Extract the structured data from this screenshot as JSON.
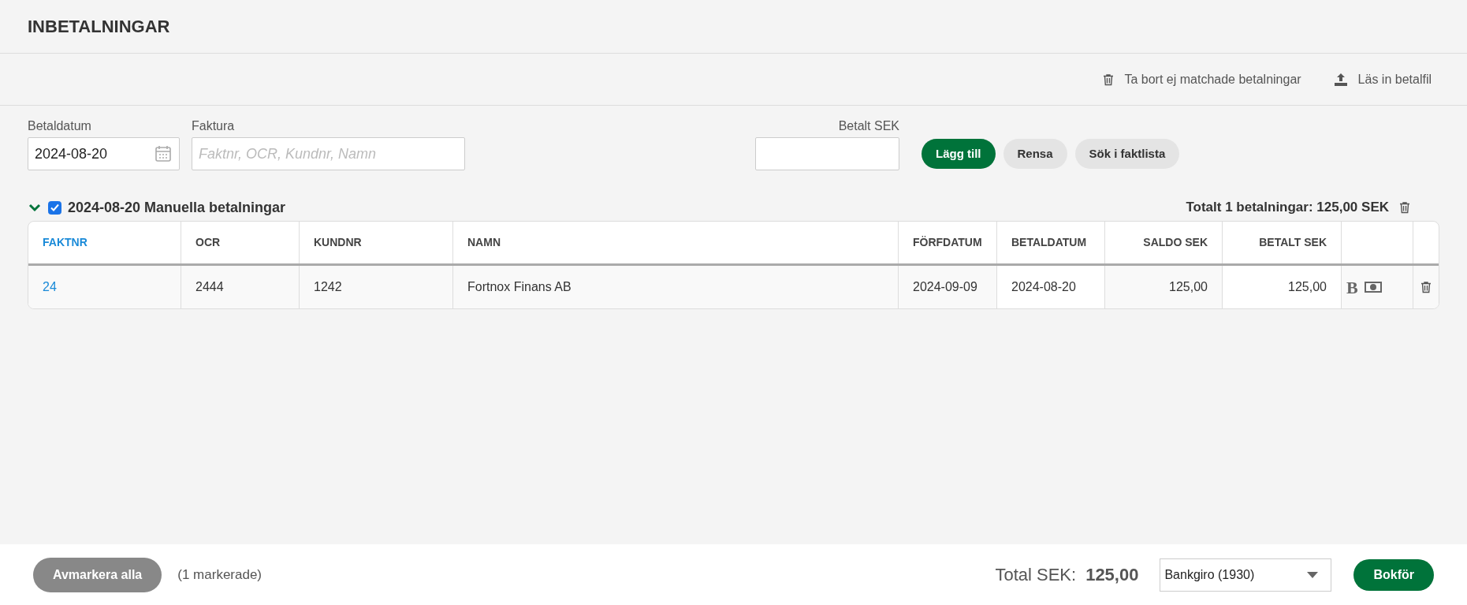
{
  "page_title": "INBETALNINGAR",
  "toolbar": [
    {
      "kind": "delete",
      "label": "Ta bort ej matchade betalningar"
    },
    {
      "kind": "upload",
      "label": "Läs in betalfil"
    }
  ],
  "form": {
    "date": {
      "label": "Betaldatum",
      "value": "2024-08-20"
    },
    "invoice": {
      "label": "Faktura",
      "placeholder": "Faktnr, OCR, Kundnr, Namn"
    },
    "amount": {
      "label": "Betalt SEK"
    },
    "buttons": [
      {
        "label": "Lägg till",
        "primary": true
      },
      {
        "label": "Rensa",
        "primary": false
      },
      {
        "label": "Sök i faktlista",
        "primary": false
      }
    ]
  },
  "group": {
    "expanded": true,
    "checked": true,
    "title": "2024-08-20 Manuella betalningar",
    "total": "Totalt 1 betalningar: 125,00 SEK"
  },
  "table": {
    "columns": [
      {
        "label": "FAKTNR",
        "sorted": true
      },
      {
        "label": "OCR",
        "sorted": false
      },
      {
        "label": "KUNDNR",
        "sorted": false
      },
      {
        "label": "NAMN",
        "sorted": false
      },
      {
        "label": "FÖRFDATUM",
        "sorted": false
      },
      {
        "label": "BETALDATUM",
        "sorted": false
      },
      {
        "label": "SALDO SEK",
        "sorted": false
      },
      {
        "label": "BETALT SEK",
        "sorted": false
      }
    ],
    "rows": [
      {
        "cells": [
          "24",
          "2444",
          "1242",
          "Fortnox Finans AB",
          "2024-09-09",
          "2024-08-20",
          "125,00",
          "125,00"
        ],
        "bold_mark": "B"
      }
    ]
  },
  "footer": {
    "deselect": "Avmarkera alla",
    "marked": "(1 markerade)",
    "total_label": "Total SEK:",
    "total_value": "125,00",
    "account": "Bankgiro (1930)",
    "post": "Bokför"
  }
}
